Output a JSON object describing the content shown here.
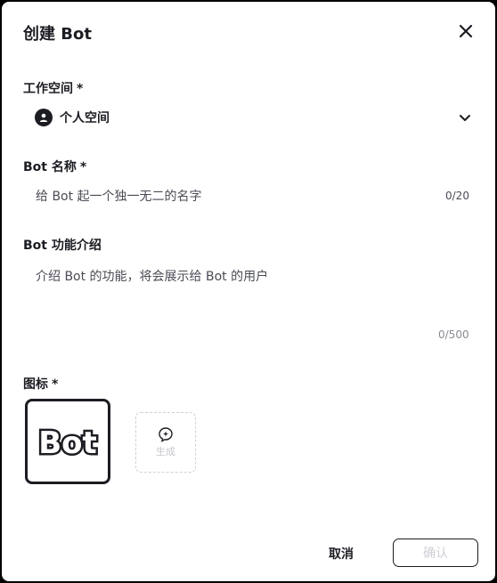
{
  "dialog": {
    "title": "创建 Bot"
  },
  "workspace": {
    "label": "工作空间",
    "required_mark": "*",
    "selected": "个人空间"
  },
  "name_field": {
    "label": "Bot 名称",
    "required_mark": "*",
    "placeholder": "给 Bot 起一个独一无二的名字",
    "counter": "0/20"
  },
  "desc_field": {
    "label": "Bot 功能介绍",
    "placeholder": "介绍 Bot 的功能，将会展示给 Bot 的用户",
    "counter": "0/500"
  },
  "icon_field": {
    "label": "图标",
    "required_mark": "*",
    "current_icon_text": "Bot",
    "generate_label": "生成"
  },
  "footer": {
    "cancel_label": "取消",
    "confirm_label": "确认"
  }
}
